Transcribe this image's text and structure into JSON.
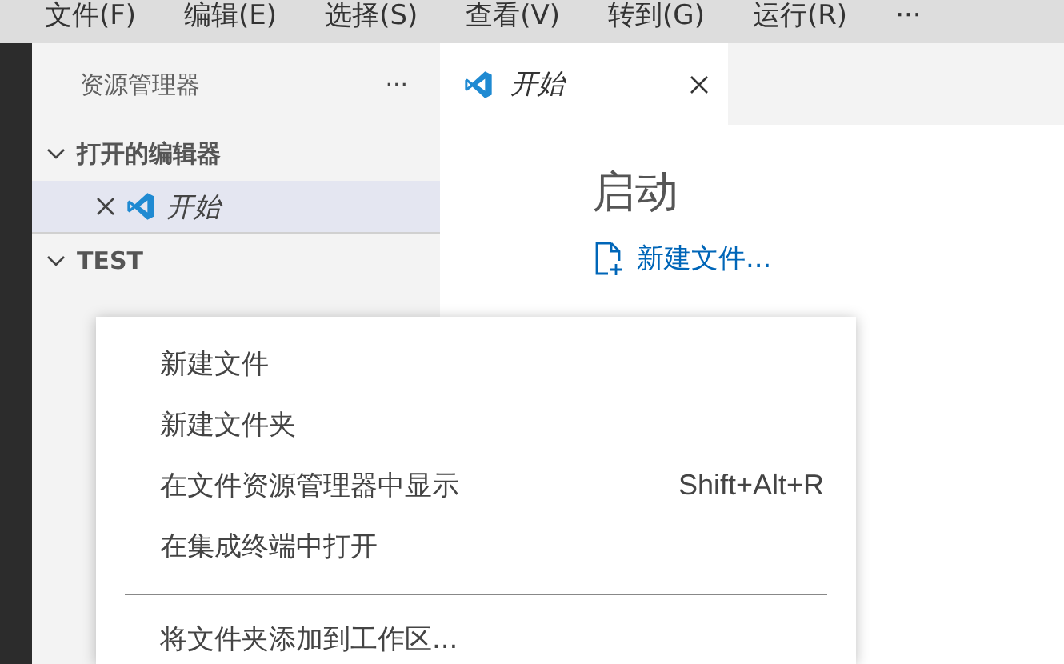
{
  "menu_bar": {
    "items": [
      "文件(F)",
      "编辑(E)",
      "选择(S)",
      "查看(V)",
      "转到(G)",
      "运行(R)"
    ],
    "more": "···"
  },
  "sidebar": {
    "title": "资源管理器",
    "more": "···",
    "sections": [
      {
        "label": "打开的编辑器",
        "expanded": true,
        "items": [
          {
            "label": "开始",
            "selected": true
          }
        ]
      },
      {
        "label": "TEST",
        "expanded": true
      }
    ]
  },
  "editor": {
    "tabs": [
      {
        "label": "开始",
        "selected": true
      }
    ],
    "heading": "启动",
    "links": [
      "新建文件..."
    ]
  },
  "context_menu": {
    "groups": [
      [
        {
          "label": "新建文件"
        },
        {
          "label": "新建文件夹"
        },
        {
          "label": "在文件资源管理器中显示",
          "shortcut": "Shift+Alt+R"
        },
        {
          "label": "在集成终端中打开"
        }
      ],
      [
        {
          "label": "将文件夹添加到工作区..."
        }
      ]
    ]
  }
}
